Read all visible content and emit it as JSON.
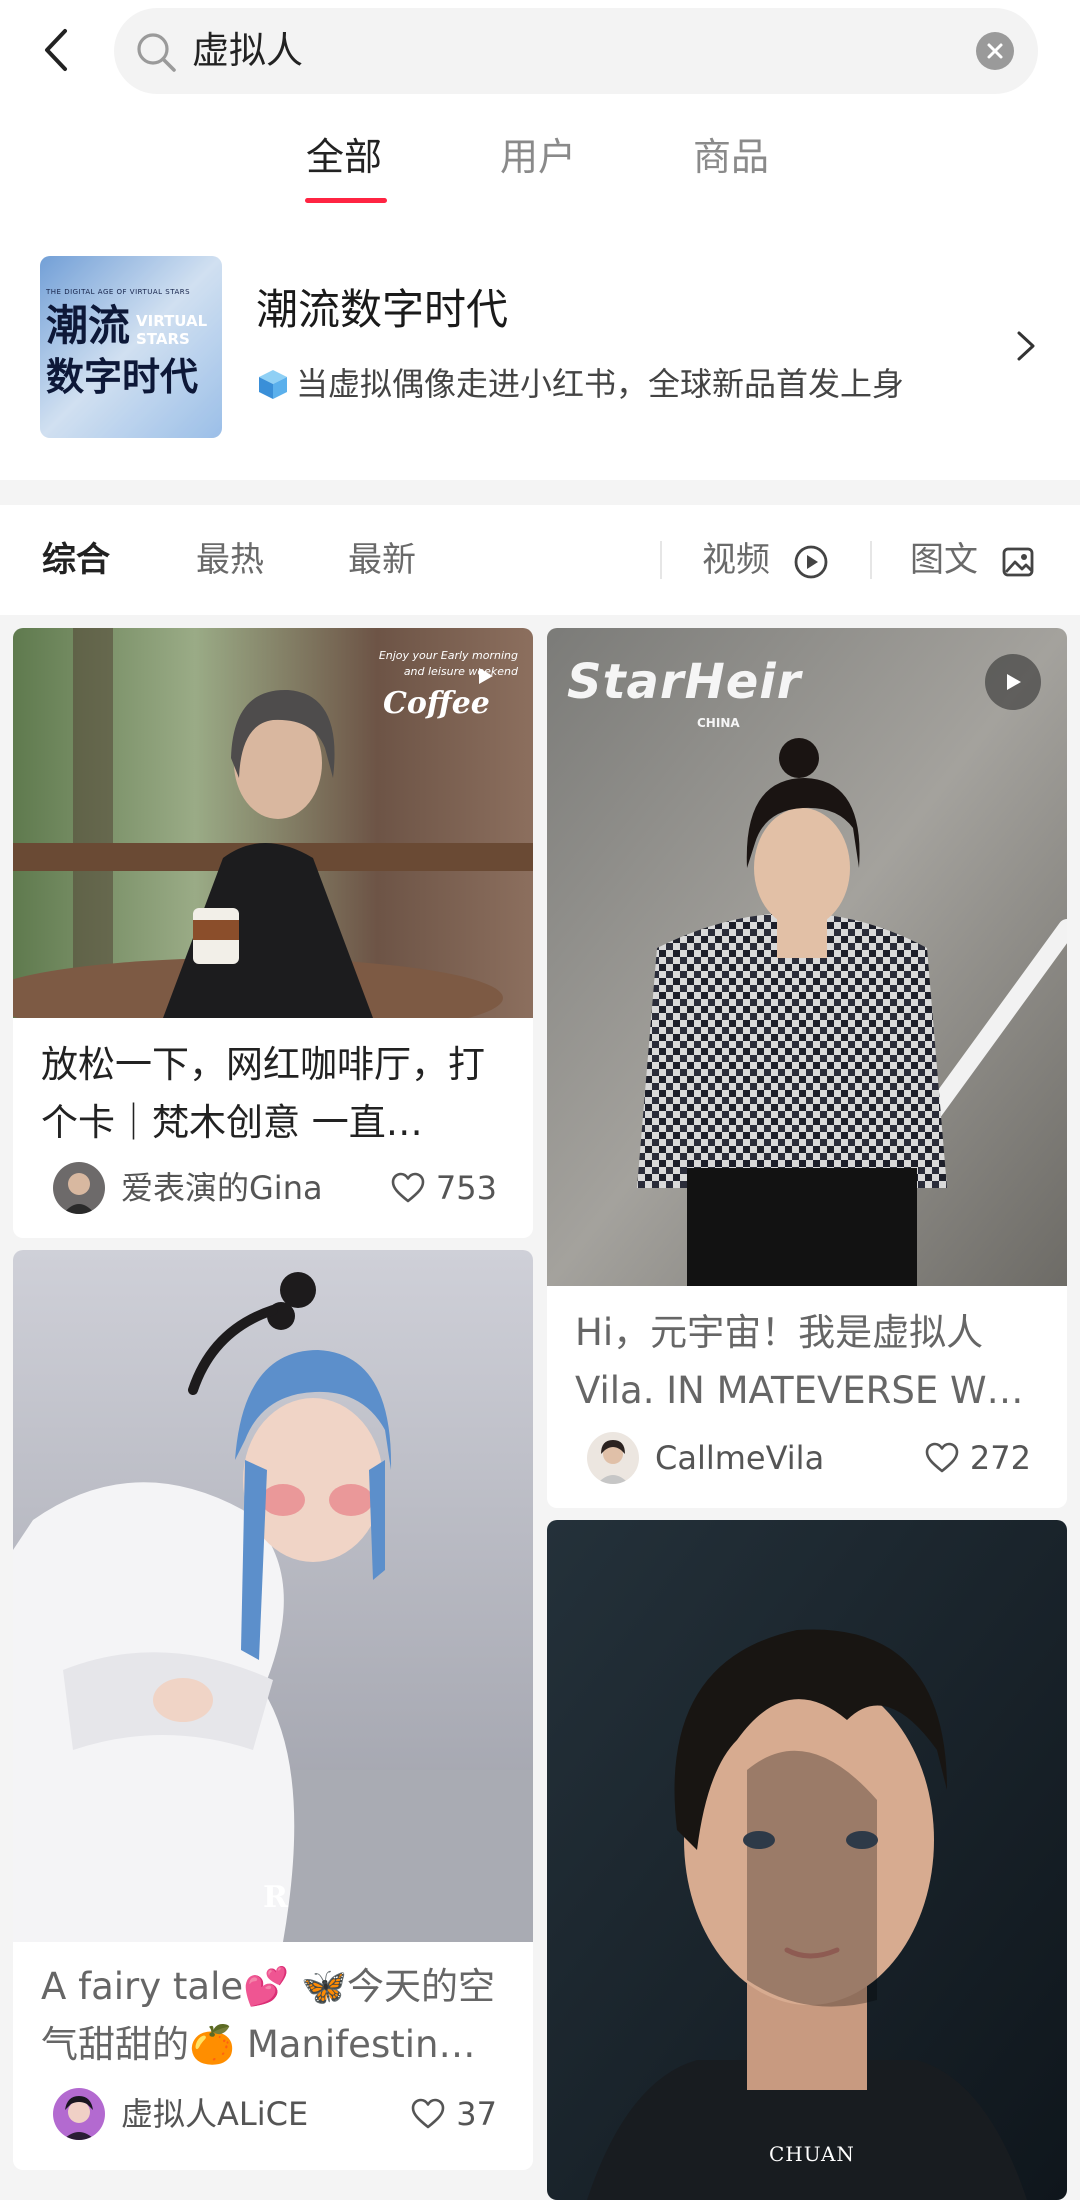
{
  "search": {
    "query": "虚拟人"
  },
  "tabs": [
    {
      "label": "全部",
      "active": true
    },
    {
      "label": "用户",
      "active": false
    },
    {
      "label": "商品",
      "active": false
    }
  ],
  "topic": {
    "title": "潮流数字时代",
    "subtitle": "当虚拟偶像走进小红书，全球新品首发上身",
    "cover": {
      "caption": "THE DIGITAL AGE OF VIRTUAL STARS",
      "line1": "潮流",
      "line2": "数字时代",
      "overlay": "VIRTUAL STARS"
    }
  },
  "filters": {
    "sort": [
      {
        "label": "综合",
        "active": true
      },
      {
        "label": "最热",
        "active": false
      },
      {
        "label": "最新",
        "active": false
      }
    ],
    "video_label": "视频",
    "image_text_label": "图文"
  },
  "feed": [
    {
      "id": "card1",
      "title": "放松一下，网红咖啡厅，打个卡｜梵木创意 一直…",
      "author": "爱表演的Gina",
      "likes": "753",
      "is_video": true,
      "overlay_small": "Enjoy your Early morning and leisure weekend",
      "overlay_big": "Coffee"
    },
    {
      "id": "card2",
      "title": "Hi，元宇宙！我是虚拟人Vila. IN MATEVERSE W…",
      "author": "CallmeVila",
      "likes": "272",
      "is_video": true,
      "overlay_big": "StarHeir",
      "overlay_small": "CHINA"
    },
    {
      "id": "card3",
      "title": "A fairy tale💕 🦋今天的空气甜甜的🍊 Manifestin…",
      "author": "虚拟人ALiCE",
      "likes": "37",
      "is_video": false
    },
    {
      "id": "card4",
      "watermark": "CHUAN",
      "is_video": false
    }
  ],
  "colors": {
    "accent": "#ff2442",
    "background": "#f4f4f4"
  }
}
